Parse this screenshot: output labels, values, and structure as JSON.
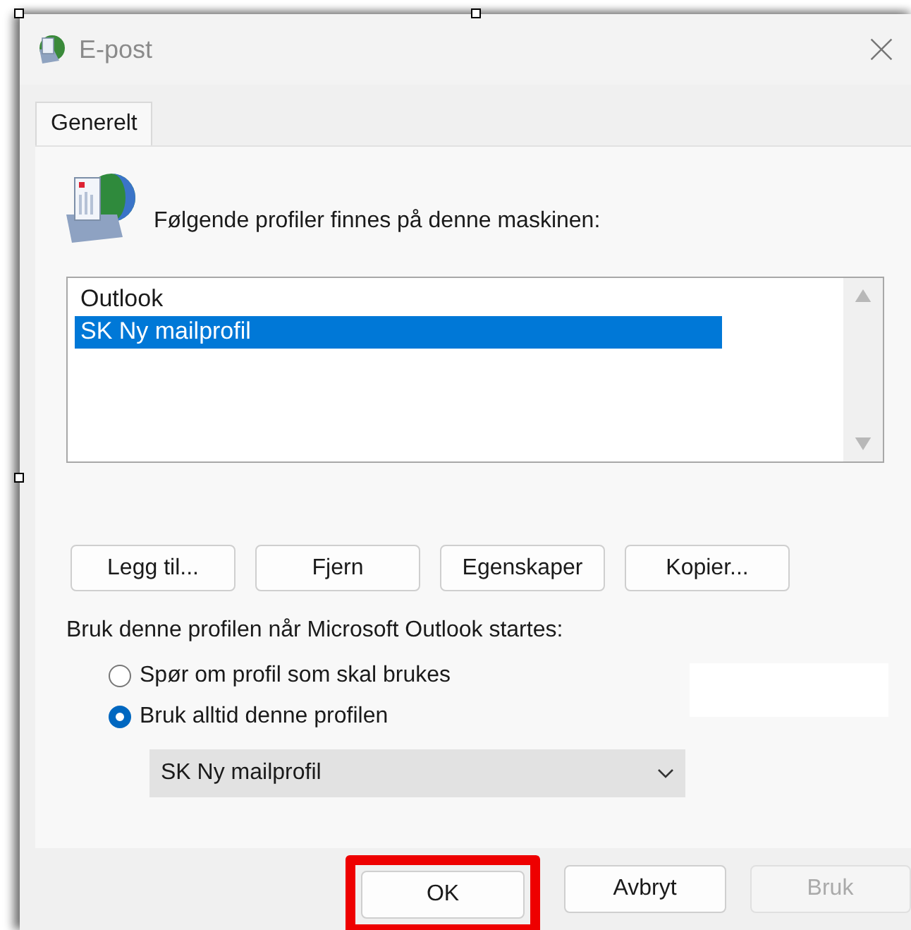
{
  "window": {
    "title": "E-post"
  },
  "tabs": [
    {
      "label": "Generelt",
      "selected": true
    }
  ],
  "profiles_label": "Følgende profiler finnes på denne maskinen:",
  "profiles": [
    {
      "name": "Outlook",
      "selected": false
    },
    {
      "name": "SK Ny mailprofil",
      "selected": true
    }
  ],
  "profile_buttons": [
    "Legg til...",
    "Fjern",
    "Egenskaper",
    "Kopier..."
  ],
  "startup_label": "Bruk denne profilen når Microsoft Outlook startes:",
  "startup_options": [
    {
      "label": "Spør om profil som skal brukes",
      "selected": false
    },
    {
      "label": "Bruk alltid denne profilen",
      "selected": true
    }
  ],
  "profile_dropdown": {
    "value": "SK Ny mailprofil"
  },
  "buttons": [
    {
      "label": "OK",
      "disabled": false,
      "highlighted": true
    },
    {
      "label": "Avbryt",
      "disabled": false,
      "highlighted": false
    },
    {
      "label": "Bruk",
      "disabled": true,
      "highlighted": false
    }
  ]
}
